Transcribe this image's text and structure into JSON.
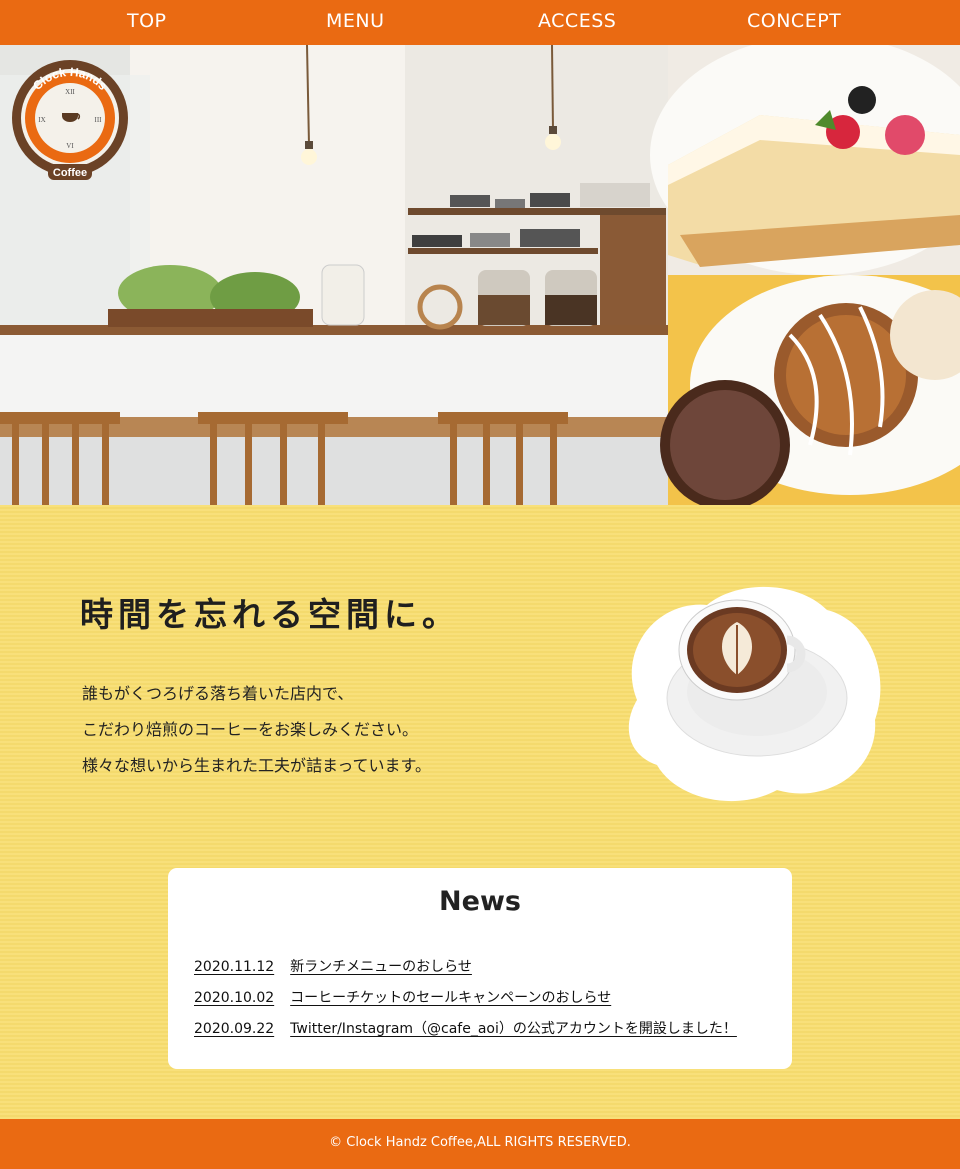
{
  "nav": {
    "items": [
      "TOP",
      "MENU",
      "ACCESS",
      "CONCEPT"
    ]
  },
  "logo": {
    "top_text": "Clock Hands",
    "bottom_text": "Coffee",
    "numerals": [
      "XII",
      "III",
      "VI",
      "IX"
    ]
  },
  "concept": {
    "catch": "時間を忘れる空間に。",
    "lines": [
      "誰もがくつろげる落ち着いた店内で、",
      "こだわり焙煎のコーヒーをお楽しみください。",
      "様々な想いから生まれた工夫が詰まっています。"
    ]
  },
  "news": {
    "title": "News",
    "items": [
      {
        "date": "2020.11.12",
        "text": "新ランチメニューのおしらせ"
      },
      {
        "date": "2020.10.02",
        "text": "コーヒーチケットのセールキャンペーンのおしらせ"
      },
      {
        "date": "2020.09.22",
        "text": "Twitter/Instagram（@cafe_aoi）の公式アカウントを開設しました！"
      }
    ]
  },
  "footer": {
    "copyright": "© Clock Handz Coffee,ALL RIGHTS RESERVED."
  },
  "colors": {
    "accent": "#ea6a12",
    "background": "#f8dd6f",
    "logo_brown": "#6b4226"
  }
}
